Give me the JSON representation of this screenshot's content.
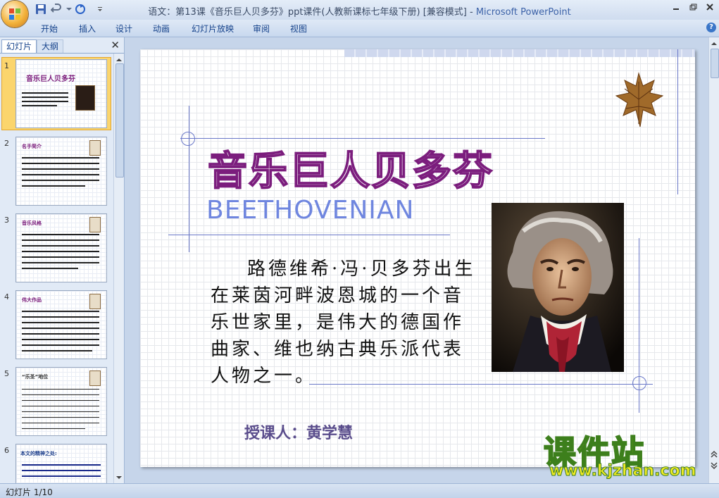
{
  "window": {
    "title": "语文：第13课《音乐巨人贝多芬》ppt课件(人教新课标七年级下册) [兼容模式]",
    "title_separator": " - ",
    "app_name": "Microsoft PowerPoint"
  },
  "ribbon": {
    "tabs": [
      "开始",
      "插入",
      "设计",
      "动画",
      "幻灯片放映",
      "审阅",
      "视图"
    ],
    "help": "?"
  },
  "pane": {
    "tab_slides": "幻灯片",
    "tab_outline": "大纲",
    "close": "✕"
  },
  "thumbnails": [
    {
      "num": "1",
      "title": "音乐巨人贝多芬"
    },
    {
      "num": "2",
      "title": "名手简介"
    },
    {
      "num": "3",
      "title": "音乐风格"
    },
    {
      "num": "4",
      "title": "伟大作品"
    },
    {
      "num": "5",
      "title": "“乐圣”地位"
    },
    {
      "num": "6",
      "title": "本文的精神之处:"
    }
  ],
  "slide": {
    "title": "音乐巨人贝多芬",
    "subtitle": "BEETHOVENIAN",
    "body": "路德维希·冯·贝多芬出生在莱茵河畔波恩城的一个音乐世家里，是伟大的德国作曲家、维也纳古典乐派代表人物之一。",
    "teacher": "授课人：黄学慧"
  },
  "watermark": {
    "brand": "课件站",
    "url": "www.kjzhan.com"
  },
  "status": {
    "text": "幻灯片 1/10"
  },
  "colors": {
    "title_outline": "#7b1d7d",
    "subtitle": "#6f86df",
    "selected_thumb": "#fbd56d",
    "watermark": "#f0ea23"
  }
}
